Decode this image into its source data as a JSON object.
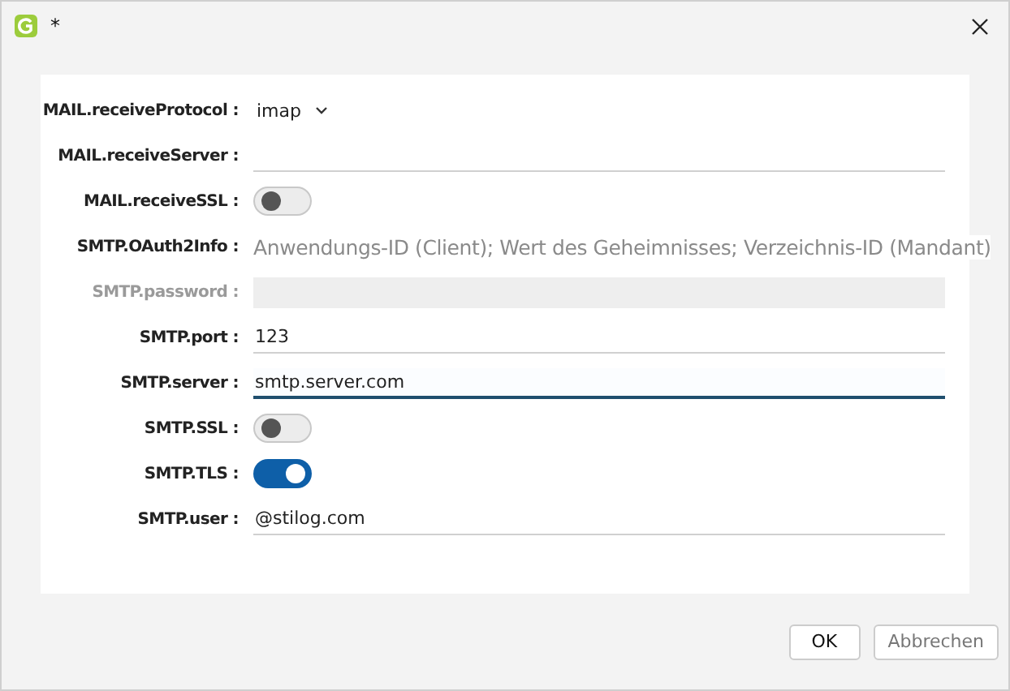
{
  "window": {
    "title": "*"
  },
  "fields": [
    {
      "kind": "dropdown",
      "label": "MAIL.receiveProtocol :",
      "value": "imap",
      "disabled": false
    },
    {
      "kind": "text",
      "label": "MAIL.receiveServer :",
      "disabled": false,
      "focused": false
    },
    {
      "kind": "toggle",
      "label": "MAIL.receiveSSL :",
      "on": false,
      "disabled": false
    },
    {
      "kind": "info",
      "label": "SMTP.OAuth2Info :",
      "value": "Anwendungs-ID (Client); Wert des Geheimnisses; Verzeichnis-ID (Mandant)",
      "disabled": false
    },
    {
      "kind": "text",
      "label": "SMTP.password :",
      "disabled": true,
      "focused": false
    },
    {
      "kind": "text",
      "label": "SMTP.port :",
      "value": "123",
      "disabled": false,
      "focused": false
    },
    {
      "kind": "text",
      "label": "SMTP.server :",
      "value": "smtp.server.com",
      "disabled": false,
      "focused": true
    },
    {
      "kind": "toggle",
      "label": "SMTP.SSL :",
      "on": false,
      "disabled": false
    },
    {
      "kind": "toggle",
      "label": "SMTP.TLS :",
      "on": true,
      "disabled": false
    },
    {
      "kind": "text",
      "label": "SMTP.user :",
      "value": "@stilog.com",
      "disabled": false,
      "focused": false
    }
  ],
  "buttons": [
    {
      "label": "OK"
    },
    {
      "label": "Abbrechen"
    }
  ]
}
